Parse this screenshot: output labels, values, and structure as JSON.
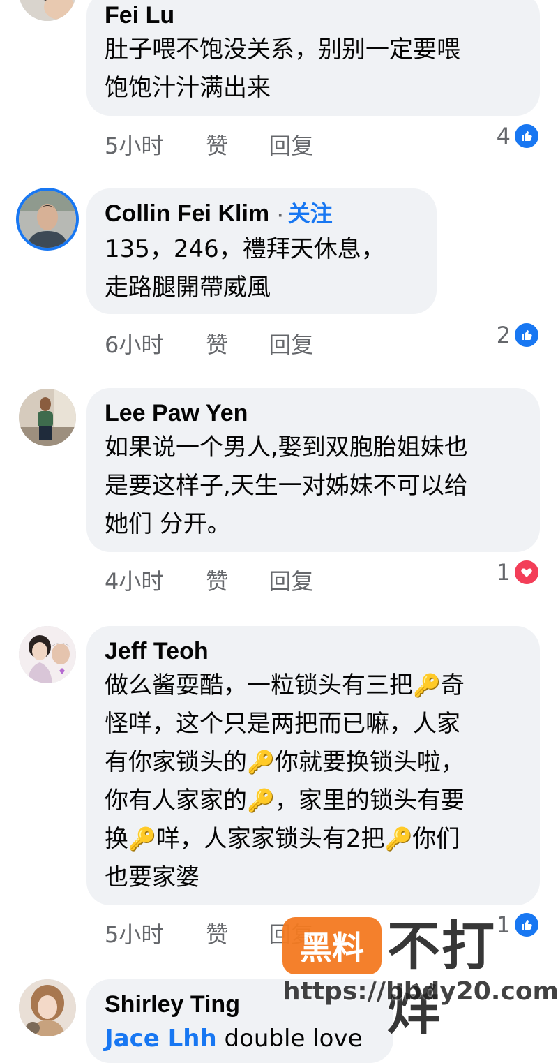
{
  "comments": [
    {
      "name": "Fei Lu",
      "lines": [
        "肚子喂不饱没关系，别别一定要喂",
        "饱饱汁汁满出来"
      ],
      "time": "5小时",
      "like_label": "赞",
      "reply_label": "回复",
      "reaction_count": "4",
      "reaction": "like-icon"
    },
    {
      "name": "Collin Fei Klim",
      "follow_dot": "·",
      "follow_label": "关注",
      "lines": [
        "135，246，禮拜天休息，",
        "走路腿開帶威風"
      ],
      "time": "6小时",
      "like_label": "赞",
      "reply_label": "回复",
      "reaction_count": "2",
      "reaction": "like-icon"
    },
    {
      "name": "Lee Paw Yen",
      "lines": [
        "如果说一个男人,娶到双胞胎姐妹也",
        "是要这样子,天生一对姊妹不可以给",
        "她们 分开。"
      ],
      "time": "4小时",
      "like_label": "赞",
      "reply_label": "回复",
      "reaction_count": "1",
      "reaction": "love-icon"
    },
    {
      "name": "Jeff Teoh",
      "lines": [
        [
          "做么酱耍酷，一粒锁头有三把",
          "🔑",
          "奇"
        ],
        [
          "怪咩，这个只是两把而已嘛，人家"
        ],
        [
          "有你家锁头的",
          "🔑",
          "你就要换锁头啦，"
        ],
        [
          "你有人家家的",
          "🔑",
          "，家里的锁头有要"
        ],
        [
          "换",
          "🔑",
          "咩，人家家锁头有2把",
          "🔑",
          "你们"
        ],
        [
          "也要家婆"
        ]
      ],
      "time": "5小时",
      "like_label": "赞",
      "reply_label": "回复",
      "reaction_count": "1",
      "reaction": "like-icon"
    },
    {
      "name": "Shirley Ting",
      "partial_mention": "Jace Lhh",
      "partial_text": " double love"
    }
  ],
  "watermark": {
    "badge": "黑料",
    "text": "不打烊",
    "url": "https://bbdy20.com"
  },
  "colors": {
    "accent": "#1877f2",
    "love": "#f33e58",
    "bubble": "#f0f2f5",
    "meta": "#65676b"
  }
}
